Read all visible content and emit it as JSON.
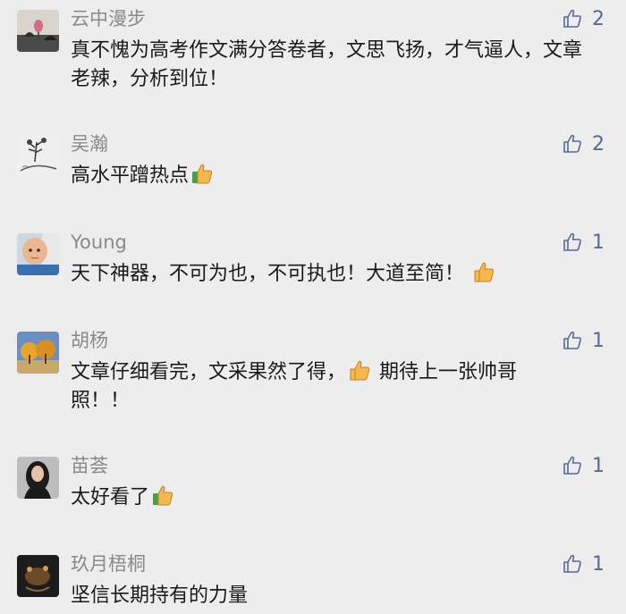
{
  "comments": [
    {
      "author": "云中漫步",
      "likes": "2",
      "text_segments": [
        "真不愧为高考作文满分答卷者，文思飞扬，才气逼人，文章老辣，分析到位！"
      ],
      "emoji_after": [],
      "avatar_icon": "ink-lotus-avatar"
    },
    {
      "author": "吴瀚",
      "likes": "2",
      "text_segments": [
        "高水平蹭热点"
      ],
      "emoji_after": [
        "thumbs-up-emoji"
      ],
      "avatar_icon": "ink-landscape-avatar"
    },
    {
      "author": "Young",
      "likes": "1",
      "text_segments": [
        "天下神器，不可为也，不可执也！大道至简！"
      ],
      "emoji_after": [
        "thumbs-up-emoji"
      ],
      "avatar_icon": "baby-photo-avatar"
    },
    {
      "author": "胡杨",
      "likes": "1",
      "text_segments": [
        "文章仔细看完，文采果然了得，",
        "期待上一张帅哥照！！"
      ],
      "emoji_after": [
        "thumbs-up-emoji"
      ],
      "avatar_icon": "desert-trees-avatar"
    },
    {
      "author": "苗荟",
      "likes": "1",
      "text_segments": [
        "太好看了"
      ],
      "emoji_after": [
        "thumbs-up-emoji"
      ],
      "avatar_icon": "woman-portrait-avatar"
    },
    {
      "author": "玖月梧桐",
      "likes": "1",
      "text_segments": [
        "坚信长期持有的力量"
      ],
      "emoji_after": [],
      "avatar_icon": "dark-photo-avatar"
    }
  ],
  "colors": {
    "background": "#ededed",
    "name": "#8a8a8a",
    "text": "#1a1a1a",
    "like": "#576b95"
  }
}
